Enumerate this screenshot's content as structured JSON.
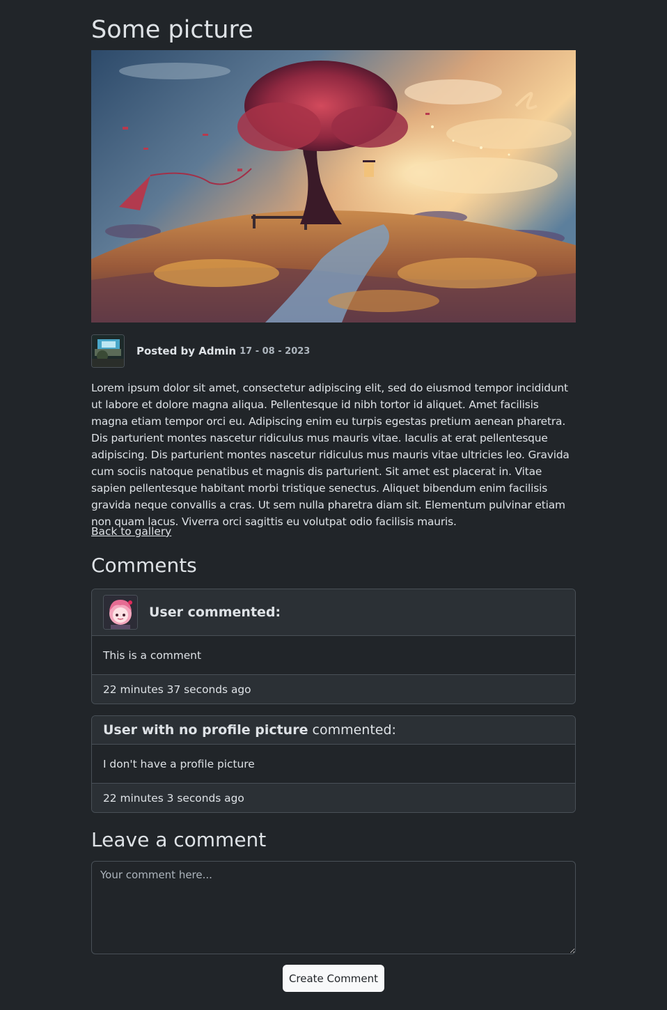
{
  "page": {
    "title": "Some picture"
  },
  "post": {
    "posted_by": "Posted by Admin",
    "date": "17 - 08 - 2023",
    "body": "Lorem ipsum dolor sit amet, consectetur adipiscing elit, sed do eiusmod tempor incididunt ut labore et dolore magna aliqua. Pellentesque id nibh tortor id aliquet. Amet facilisis magna etiam tempor orci eu. Adipiscing enim eu turpis egestas pretium aenean pharetra. Dis parturient montes nascetur ridiculus mus mauris vitae. Iaculis at erat pellentesque adipiscing. Dis parturient montes nascetur ridiculus mus mauris vitae ultricies leo. Gravida cum sociis natoque penatibus et magnis dis parturient. Sit amet est placerat in. Vitae sapien pellentesque habitant morbi tristique senectus. Aliquet bibendum enim facilisis gravida neque convallis a cras. Ut sem nulla pharetra diam sit. Elementum pulvinar etiam non quam lacus. Viverra orci sagittis eu volutpat odio facilisis mauris.",
    "back_link": "Back to gallery"
  },
  "comments": {
    "title": "Comments",
    "items": [
      {
        "author": "User",
        "suffix": " commented:",
        "text": "This is a comment",
        "time": "22 minutes 37 seconds ago",
        "has_avatar": true
      },
      {
        "author": "User with no profile picture",
        "suffix": " commented:",
        "text": "I don't have a profile picture",
        "time": "22 minutes 3 seconds ago",
        "has_avatar": false
      }
    ]
  },
  "leave_comment": {
    "title": "Leave a comment",
    "placeholder": "Your comment here...",
    "button": "Create Comment"
  },
  "colors": {
    "background": "#212529",
    "card_header": "#2b3035",
    "border": "#495057",
    "text": "#dee2e6",
    "muted": "#adb5bd",
    "button_bg": "#f8f9fa"
  }
}
